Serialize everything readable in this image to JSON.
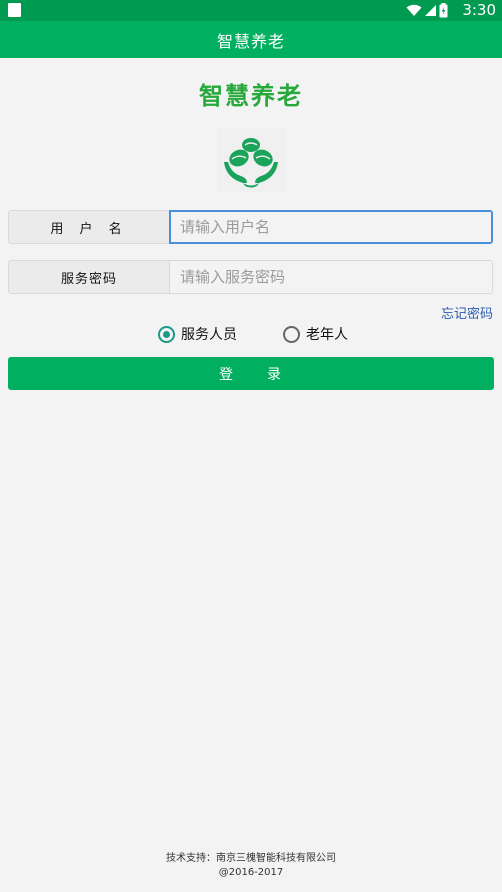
{
  "status_bar": {
    "time": "3:30",
    "icons": [
      "wifi-icon",
      "signal-icon",
      "battery-icon"
    ],
    "background": "#009b50"
  },
  "app_bar": {
    "title": "智慧养老",
    "background": "#00b060"
  },
  "header": {
    "app_name": "智慧养老",
    "app_name_color": "#27a93c"
  },
  "form": {
    "username": {
      "label": "用 户 名",
      "placeholder": "请输入用户名",
      "value": ""
    },
    "password": {
      "label": "服务密码",
      "placeholder": "请输入服务密码",
      "value": ""
    },
    "forgot_password": "忘记密码",
    "roles": [
      {
        "label": "服务人员",
        "checked": true
      },
      {
        "label": "老年人",
        "checked": false
      }
    ],
    "login_label": "登　　录"
  },
  "footer": {
    "support": "技术支持：南京三槐智能科技有限公司",
    "copyright": "@2016-2017"
  },
  "colors": {
    "accent": "#00b060",
    "link": "#2a5db0",
    "radio_checked": "#1a9a8a",
    "focus_border": "#4a90d9"
  }
}
